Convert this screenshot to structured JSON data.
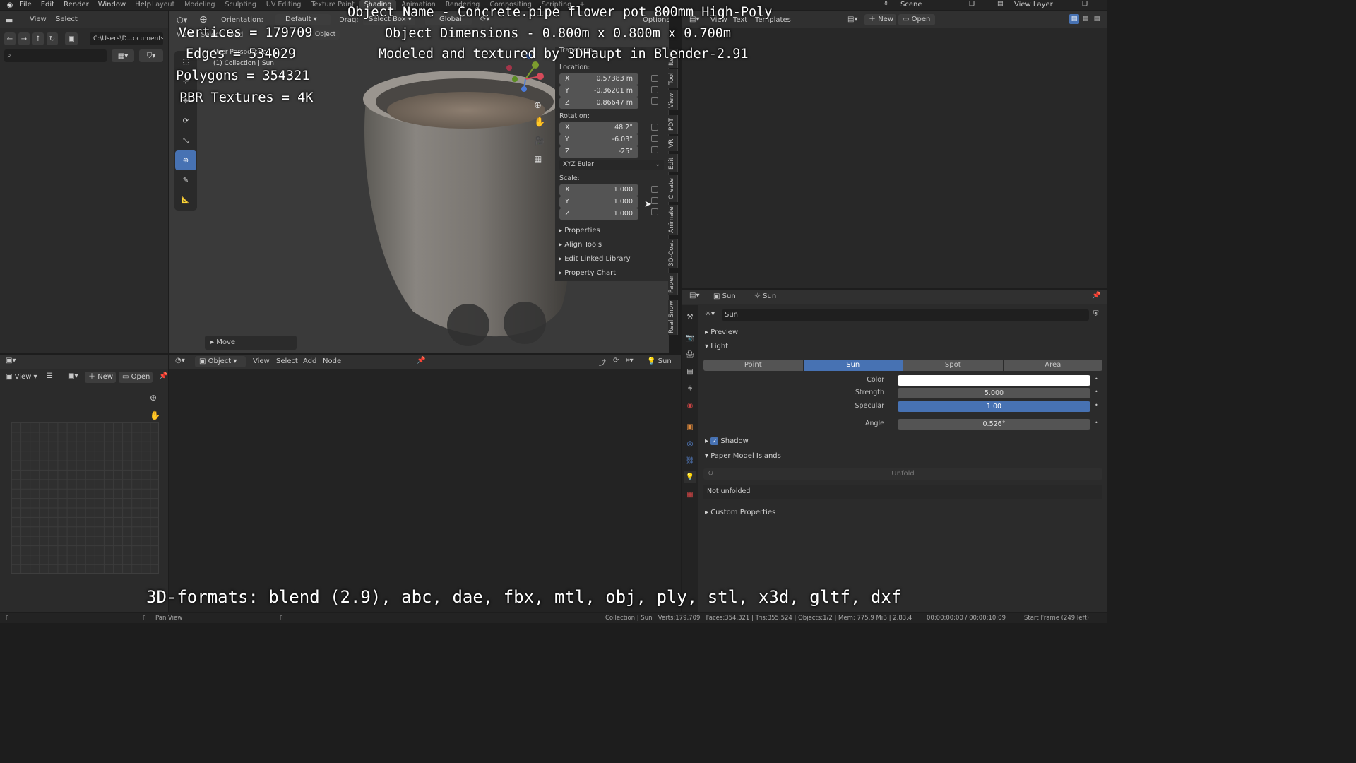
{
  "topbar": {
    "menus": [
      "File",
      "Edit",
      "Render",
      "Window",
      "Help"
    ],
    "workspaces": [
      "Layout",
      "Modeling",
      "Sculpting",
      "UV Editing",
      "Texture Paint",
      "Shading",
      "Animation",
      "Rendering",
      "Compositing",
      "Scripting",
      "+"
    ],
    "active_workspace": "Shading",
    "scene": "Scene",
    "view_layer": "View Layer"
  },
  "filebrowser": {
    "menus": [
      "View",
      "Select"
    ],
    "path": "C:\\Users\\D...ocuments\\"
  },
  "viewport": {
    "orientation_label": "Orientation:",
    "orientation_value": "Default",
    "drag_label": "Drag:",
    "drag_value": "Select Box",
    "transform_space": "Global",
    "options": "Options",
    "header_items": [
      "View",
      "Select",
      "Add",
      "Object"
    ],
    "perspective_title": "User Perspective",
    "collection_info": "(1) Collection | Sun",
    "move_panel": "Move"
  },
  "overlay": {
    "vertices": "Vertices = 179709",
    "edges": "Edges = 534029",
    "polygons": "Polygons = 354321",
    "textures": "PBR Textures = 4K",
    "object_name": "Object Name - Concrete.pipe flower pot 800mm High-Poly",
    "dimensions": "Object Dimensions - 0.800m x 0.800m x 0.700m",
    "credit": "Modeled and textured by 3DHaupt in Blender-2.91",
    "formats": "3D-formats: blend (2.9), abc, dae, fbx, mtl, obj, ply, stl, x3d, gltf, dxf"
  },
  "npanel": {
    "title": "Transform",
    "location_label": "Location:",
    "location": [
      {
        "axis": "X",
        "value": "0.57383 m"
      },
      {
        "axis": "Y",
        "value": "-0.36201 m"
      },
      {
        "axis": "Z",
        "value": "0.86647 m"
      }
    ],
    "rotation_label": "Rotation:",
    "rotation": [
      {
        "axis": "X",
        "value": "48.2°"
      },
      {
        "axis": "Y",
        "value": "-6.03°"
      },
      {
        "axis": "Z",
        "value": "-25°"
      }
    ],
    "rotation_mode": "XYZ Euler",
    "scale_label": "Scale:",
    "scale": [
      {
        "axis": "X",
        "value": "1.000"
      },
      {
        "axis": "Y",
        "value": "1.000"
      },
      {
        "axis": "Z",
        "value": "1.000"
      }
    ],
    "sections": [
      "Properties",
      "Align Tools",
      "Edit Linked Library",
      "Property Chart"
    ],
    "tabs": [
      "Item",
      "Tool",
      "View",
      "PDT",
      "VR",
      "Edit",
      "Create",
      "Animate",
      "3D-Coat",
      "Paper",
      "Real Snow"
    ]
  },
  "texteditor": {
    "menus": [
      "View",
      "Text",
      "Templates"
    ],
    "new": "New",
    "open": "Open"
  },
  "imageeditor": {
    "view": "View",
    "new": "New",
    "open": "Open"
  },
  "nodeeditor": {
    "mode": "Object",
    "menus": [
      "View",
      "Select",
      "Add",
      "Node"
    ],
    "object": "Sun"
  },
  "properties": {
    "breadcrumb_obj": "Sun",
    "breadcrumb_data": "Sun",
    "datablock": "Sun",
    "preview": "Preview",
    "light": "Light",
    "light_types": [
      "Point",
      "Sun",
      "Spot",
      "Area"
    ],
    "active_type": "Sun",
    "color_label": "Color",
    "strength_label": "Strength",
    "strength": "5.000",
    "specular_label": "Specular",
    "specular": "1.00",
    "specular_fraction": 1.0,
    "angle_label": "Angle",
    "angle": "0.526°",
    "shadow": "Shadow",
    "paper_model": "Paper Model Islands",
    "unfold": "Unfold",
    "not_unfolded": "Not unfolded",
    "custom_props": "Custom Properties"
  },
  "statusbar": {
    "pan_view": "Pan View",
    "stats": "Collection | Sun | Verts:179,709 | Faces:354,321 | Tris:355,524 | Objects:1/2 | Mem: 775.9 MiB | 2.83.4",
    "time": "00:00:00:00 / 00:00:10:09",
    "frame": "Start Frame (249 left)"
  },
  "colors": {
    "accent": "#4772b3",
    "panel": "#303030",
    "field": "#545454",
    "viewport": "#3a3a3a"
  }
}
